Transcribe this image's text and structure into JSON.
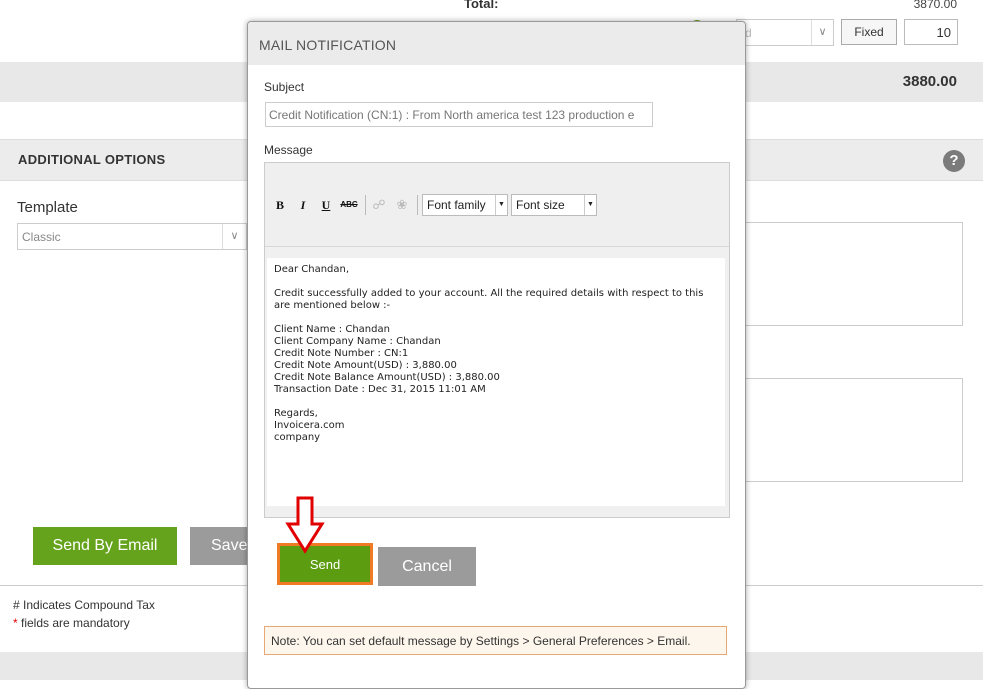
{
  "background": {
    "totals": {
      "total_label": "Total:",
      "total_value": "3870.00",
      "discount_select_value": "d",
      "fixed_label": "Fixed",
      "discount_value": "10",
      "grand_total": "3880.00"
    },
    "additional_options": {
      "title": "ADDITIONAL OPTIONS",
      "help_glyph": "?",
      "template_label": "Template",
      "template_value": "Classic"
    },
    "actions": {
      "send_by_email": "Send By Email",
      "save": "Save"
    },
    "footnotes": {
      "compound_tax": "# Indicates Compound Tax",
      "mandatory_star": "*",
      "mandatory_text": " fields are mandatory"
    }
  },
  "modal": {
    "title": "MAIL NOTIFICATION",
    "subject_label": "Subject",
    "subject_value": "Credit Notification (CN:1) : From North america test 123 production e",
    "message_label": "Message",
    "toolbar": {
      "bold": "B",
      "italic": "I",
      "underline": "U",
      "strikethrough": "ABC",
      "font_family": "Font family",
      "font_size": "Font size"
    },
    "body": {
      "greeting": "Dear Chandan,",
      "intro": "Credit successfully added to your account. All the required details with respect to this are mentioned below :-",
      "client_name": "Client Name : Chandan",
      "client_company": "Client Company Name : Chandan",
      "credit_note_number": "Credit Note Number : CN:1",
      "credit_note_amount": "Credit Note Amount(USD) : 3,880.00",
      "credit_note_balance": "Credit Note Balance Amount(USD) : 3,880.00",
      "transaction_date": "Transaction Date : Dec 31, 2015 11:01 AM",
      "regards": "Regards,",
      "sender_site": "Invoicera.com",
      "sender_company": "company"
    },
    "send_label": "Send",
    "cancel_label": "Cancel",
    "note": "Note: You can set default message by Settings > General Preferences > Email."
  },
  "colors": {
    "primary_green": "#66a31c",
    "highlight_orange": "#f07b25",
    "annotation_red": "#e00000",
    "neutral_gray": "#9b9b9b"
  },
  "icons": [
    "help-icon",
    "bold-icon",
    "italic-icon",
    "underline-icon",
    "strikethrough-icon",
    "link-icon",
    "unlink-icon",
    "chevron-down-icon",
    "down-arrow-annotation-icon"
  ]
}
